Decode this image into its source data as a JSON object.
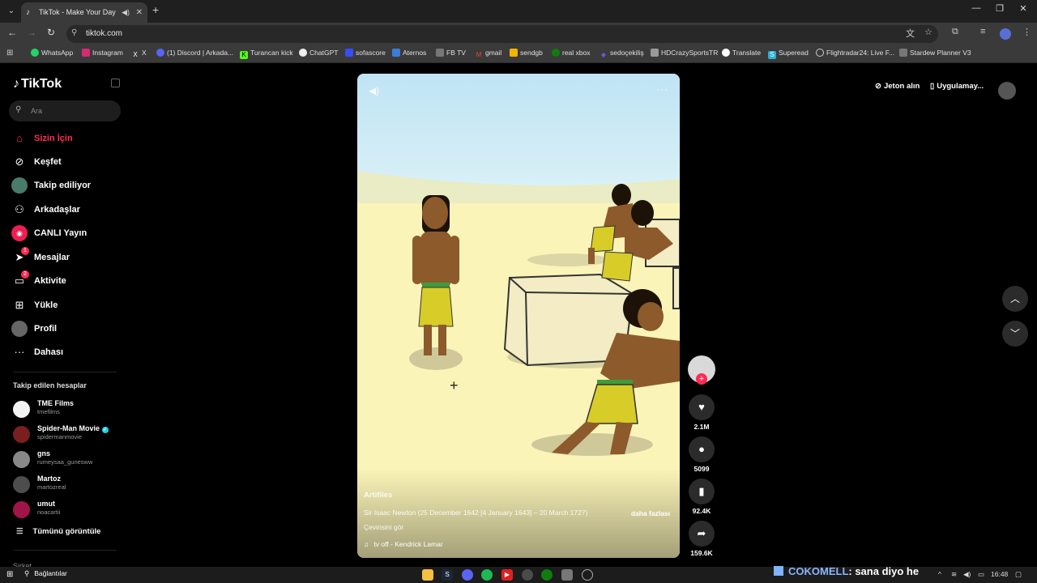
{
  "browser": {
    "tab_title": "TikTok - Make Your Day",
    "url": "tiktok.com",
    "bookmarks": [
      "WhatsApp",
      "Instagram",
      "X",
      "(1) Discord | Arkada...",
      "Turancan kick",
      "ChatGPT",
      "sofascore",
      "Aternos",
      "FB TV",
      "gmail",
      "sendgb",
      "real xbox",
      "sedoçekiliş",
      "HDCrazySportsTR",
      "Translate",
      "Superead",
      "Flightradar24: Live F...",
      "Stardew Planner V3"
    ]
  },
  "sidebar": {
    "logo": "TikTok",
    "search_placeholder": "Ara",
    "nav": [
      {
        "label": "Sizin İçin",
        "icon": "home-icon",
        "active": true
      },
      {
        "label": "Keşfet",
        "icon": "compass-icon"
      },
      {
        "label": "Takip ediliyor",
        "icon": "following-avatar"
      },
      {
        "label": "Arkadaşlar",
        "icon": "friends-icon"
      },
      {
        "label": "CANLI Yayın",
        "icon": "live-icon"
      },
      {
        "label": "Mesajlar",
        "icon": "messages-icon",
        "badge": "1"
      },
      {
        "label": "Aktivite",
        "icon": "activity-icon",
        "badge": "2"
      },
      {
        "label": "Yükle",
        "icon": "upload-icon"
      },
      {
        "label": "Profil",
        "icon": "profile-avatar"
      },
      {
        "label": "Dahası",
        "icon": "more-icon"
      }
    ],
    "following_title": "Takip edilen hesaplar",
    "accounts": [
      {
        "name": "TME Films",
        "handle": "tmefilms"
      },
      {
        "name": "Spider-Man Movie",
        "handle": "spidermanmovie",
        "verified": true
      },
      {
        "name": "gns",
        "handle": "rumeysaa_gunesww"
      },
      {
        "name": "Martoz",
        "handle": "martozreal"
      },
      {
        "name": "umut",
        "handle": "noacartii"
      }
    ],
    "see_all": "Tümünü görüntüle",
    "cut_text": "Şirket"
  },
  "video": {
    "author": "Artifiles",
    "description": "Sir Isaac Newton (25 December 1642 [4 January 1643] – 20 March 1727)",
    "more_label": "daha fazlası",
    "translate_label": "Çevirisini gör",
    "music": "tv off - Kendrick Lamar"
  },
  "actions": {
    "likes": "2.1M",
    "comments": "5099",
    "saves": "92.4K",
    "shares": "159.6K"
  },
  "header": {
    "coins": "Jeton alın",
    "app": "Uygulamay..."
  },
  "taskbar": {
    "search_label": "Bağlantılar",
    "time": "16:48"
  },
  "overlay": {
    "name": "COKOMELL",
    "message": ": sana diyo he"
  }
}
